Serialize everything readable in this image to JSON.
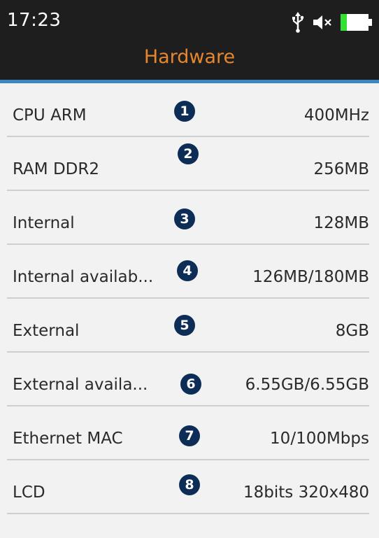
{
  "status_bar": {
    "time": "17:23",
    "icons": [
      "usb-icon",
      "speaker-muted-icon",
      "battery-icon"
    ],
    "battery_color": "#33e033"
  },
  "header": {
    "title": "Hardware",
    "title_color": "#e6862e",
    "accent_line_color": "#3d86c6"
  },
  "rows": [
    {
      "label": "CPU ARM",
      "value": "400MHz",
      "marker": "1"
    },
    {
      "label": "RAM DDR2",
      "value": "256MB",
      "marker": "2"
    },
    {
      "label": "Internal",
      "value": "128MB",
      "marker": "3"
    },
    {
      "label": "Internal availab...",
      "value": "126MB/180MB",
      "marker": "4"
    },
    {
      "label": "External",
      "value": "8GB",
      "marker": "5"
    },
    {
      "label": "External availa...",
      "value": "6.55GB/6.55GB",
      "marker": "6"
    },
    {
      "label": "Ethernet MAC",
      "value": "10/100Mbps",
      "marker": "7"
    },
    {
      "label": "LCD",
      "value": "18bits 320x480",
      "marker": "8"
    }
  ]
}
